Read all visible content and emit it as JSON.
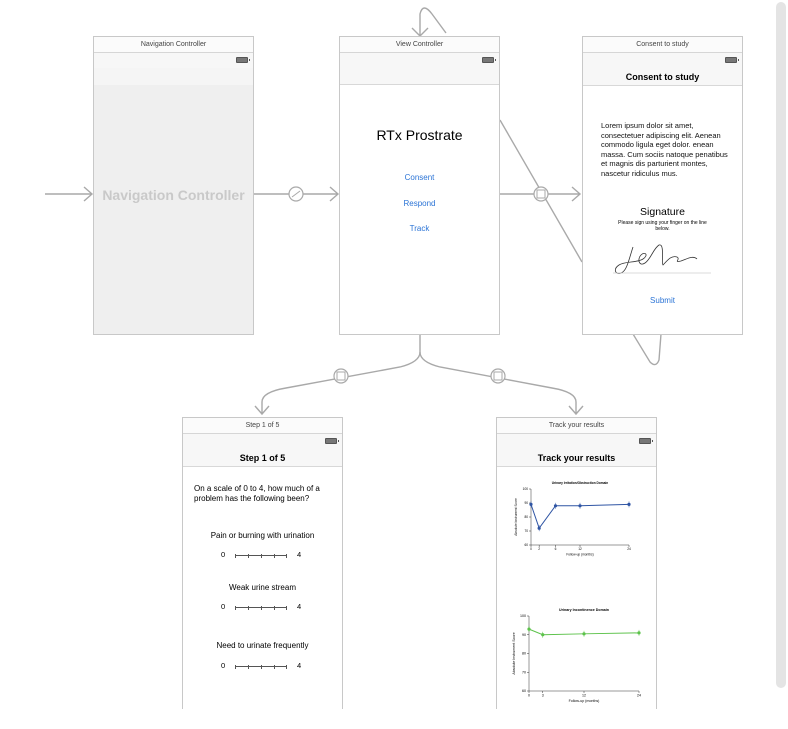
{
  "scenes": {
    "nav": {
      "title": "Navigation Controller",
      "placeholder": "Navigation Controller"
    },
    "view": {
      "title": "View Controller",
      "heading": "RTx Prostrate",
      "links": [
        "Consent",
        "Respond",
        "Track"
      ]
    },
    "consent": {
      "title": "Consent to study",
      "nav_title": "Consent to study",
      "body": "Lorem ipsum dolor sit amet, consectetuer adipiscing elit. Aenean commodo ligula eget dolor. enean massa. Cum sociis natoque penatibus et magnis dis parturient montes, nascetur ridiculus mus.",
      "signature_title": "Signature",
      "signature_hint": "Please sign using your finger on the line below.",
      "submit": "Submit"
    },
    "step": {
      "title": "Step 1 of 5",
      "nav_title": "Step 1 of 5",
      "question": "On a scale of 0 to 4, how much of a problem has the following been?",
      "items": [
        {
          "label": "Pain or burning with urination",
          "min": "0",
          "max": "4"
        },
        {
          "label": "Weak urine stream",
          "min": "0",
          "max": "4"
        },
        {
          "label": "Need to urinate frequently",
          "min": "0",
          "max": "4"
        }
      ]
    },
    "track": {
      "title": "Track your results",
      "nav_title": "Track your results"
    }
  },
  "chart_data": [
    {
      "type": "line",
      "title": "Urinary Irritation/Obstruction Domain",
      "xlabel": "Follow-up (months)",
      "ylabel": "Absolute Instrument Score",
      "x": [
        0,
        2,
        6,
        12,
        24
      ],
      "xticks": [
        "0",
        "2",
        "6",
        "12",
        "24"
      ],
      "yticks": [
        "60",
        "70",
        "80",
        "90",
        "100"
      ],
      "ylim": [
        60,
        100
      ],
      "series": [
        {
          "values": [
            89,
            72,
            88,
            88,
            89
          ]
        }
      ],
      "color": "#2f55a4"
    },
    {
      "type": "line",
      "title": "Urinary Incontinence Domain",
      "xlabel": "Follow-up (months)",
      "ylabel": "Absolute Instrument Score",
      "x": [
        0,
        3,
        12,
        24
      ],
      "xticks": [
        "0",
        "3",
        "12",
        "24"
      ],
      "yticks": [
        "60",
        "70",
        "80",
        "90",
        "100"
      ],
      "ylim": [
        60,
        100
      ],
      "series": [
        {
          "values": [
            93,
            90,
            90.5,
            91
          ]
        }
      ],
      "color": "#5cc24a"
    }
  ]
}
